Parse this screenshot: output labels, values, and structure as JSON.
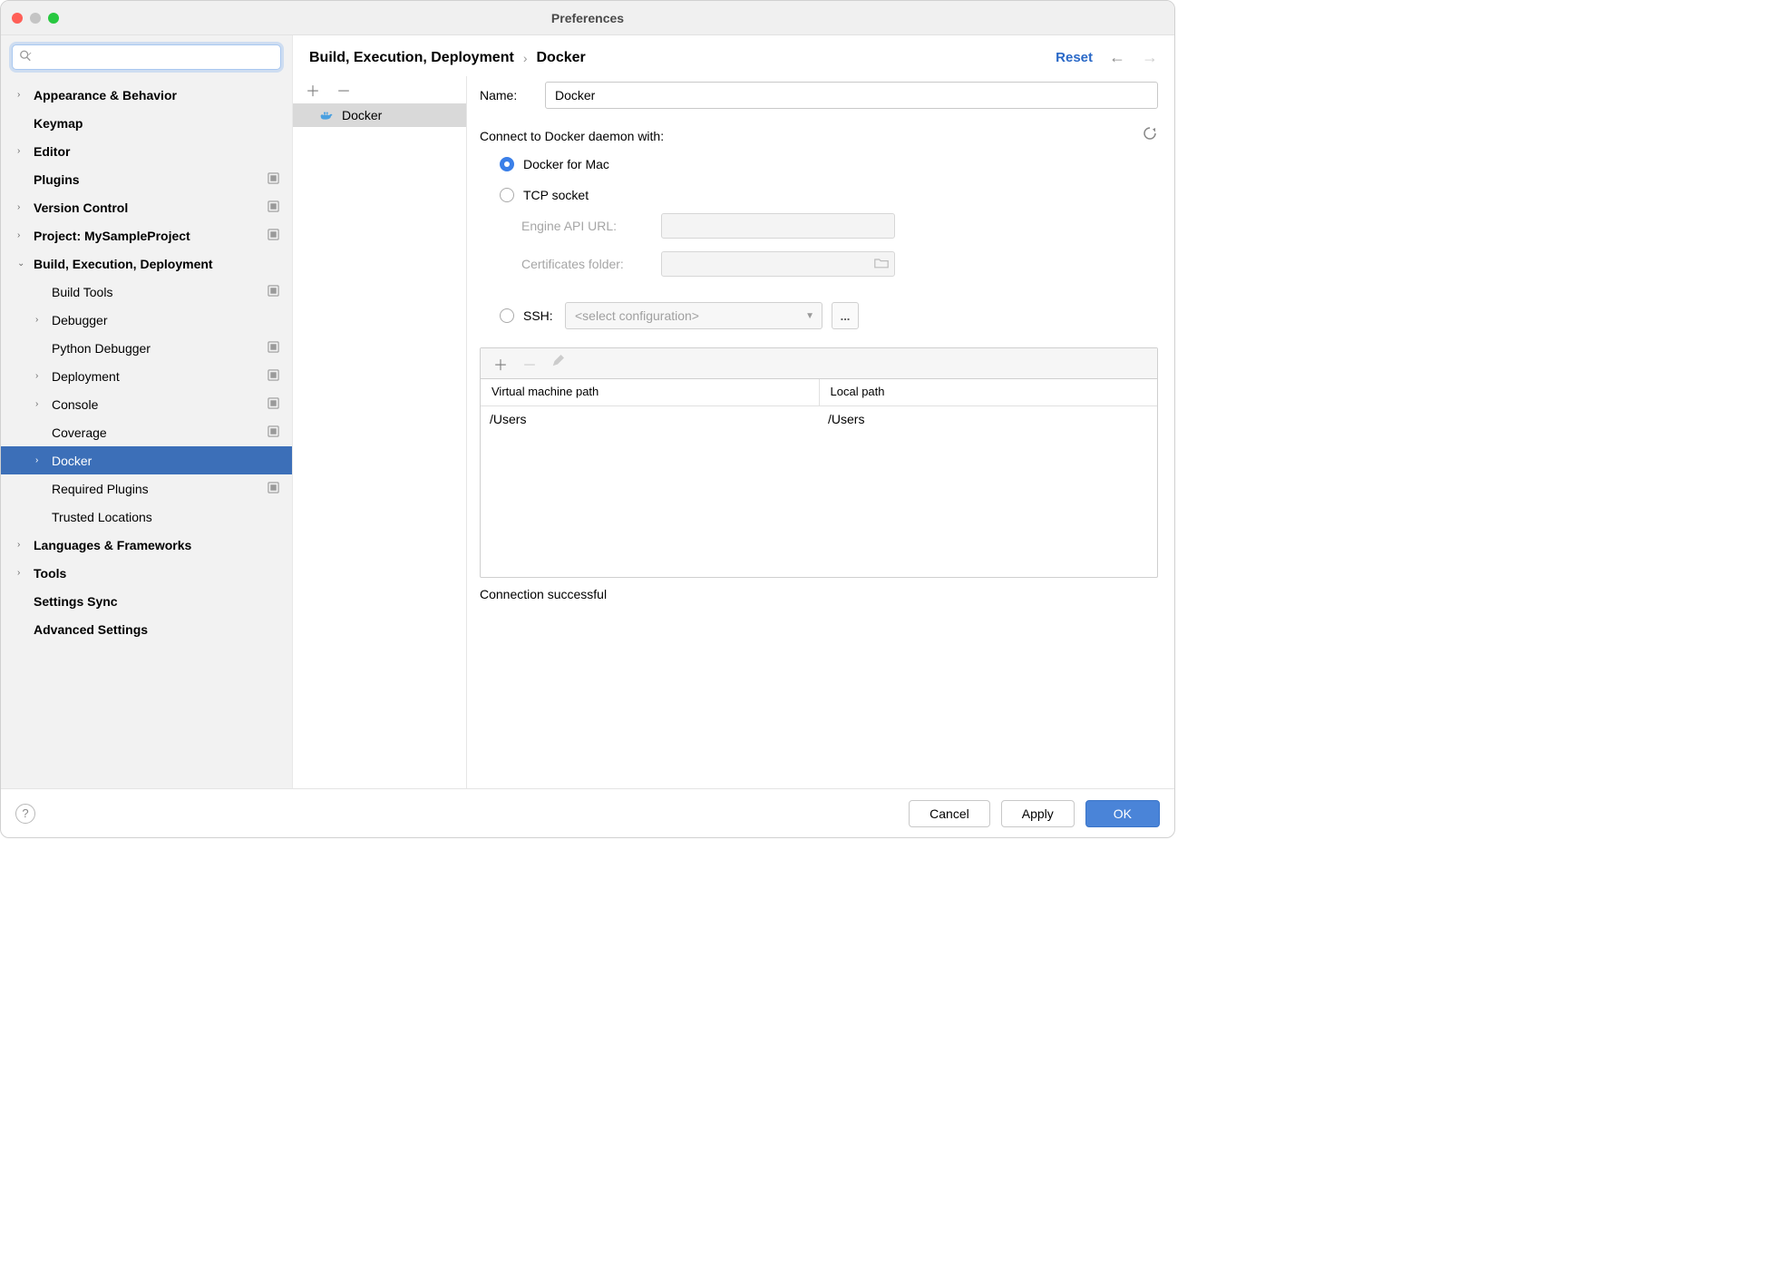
{
  "window": {
    "title": "Preferences"
  },
  "search": {
    "placeholder": ""
  },
  "sidebar": {
    "items": [
      {
        "label": "Appearance & Behavior",
        "bold": true,
        "arrow": ">",
        "badge": false
      },
      {
        "label": "Keymap",
        "bold": true,
        "arrow": "",
        "badge": false
      },
      {
        "label": "Editor",
        "bold": true,
        "arrow": ">",
        "badge": false
      },
      {
        "label": "Plugins",
        "bold": true,
        "arrow": "",
        "badge": true
      },
      {
        "label": "Version Control",
        "bold": true,
        "arrow": ">",
        "badge": true
      },
      {
        "label": "Project: MySampleProject",
        "bold": true,
        "arrow": ">",
        "badge": true
      },
      {
        "label": "Build, Execution, Deployment",
        "bold": true,
        "arrow": "v",
        "badge": false
      },
      {
        "label": "Build Tools",
        "bold": false,
        "arrow": "",
        "level": 1,
        "badge": true
      },
      {
        "label": "Debugger",
        "bold": false,
        "arrow": ">",
        "level": 1,
        "badge": false
      },
      {
        "label": "Python Debugger",
        "bold": false,
        "arrow": "",
        "level": 1,
        "badge": true
      },
      {
        "label": "Deployment",
        "bold": false,
        "arrow": ">",
        "level": 1,
        "badge": true
      },
      {
        "label": "Console",
        "bold": false,
        "arrow": ">",
        "level": 1,
        "badge": true
      },
      {
        "label": "Coverage",
        "bold": false,
        "arrow": "",
        "level": 1,
        "badge": true
      },
      {
        "label": "Docker",
        "bold": false,
        "arrow": ">",
        "level": 1,
        "selected": true,
        "badge": false
      },
      {
        "label": "Required Plugins",
        "bold": false,
        "arrow": "",
        "level": 1,
        "badge": true
      },
      {
        "label": "Trusted Locations",
        "bold": false,
        "arrow": "",
        "level": 1,
        "badge": false
      },
      {
        "label": "Languages & Frameworks",
        "bold": true,
        "arrow": ">",
        "badge": false
      },
      {
        "label": "Tools",
        "bold": true,
        "arrow": ">",
        "badge": false
      },
      {
        "label": "Settings Sync",
        "bold": true,
        "arrow": "",
        "badge": false
      },
      {
        "label": "Advanced Settings",
        "bold": true,
        "arrow": "",
        "badge": false
      }
    ]
  },
  "breadcrumb": {
    "root": "Build, Execution, Deployment",
    "sep": "›",
    "leaf": "Docker"
  },
  "reset": "Reset",
  "config_list": {
    "items": [
      {
        "label": "Docker"
      }
    ]
  },
  "detail": {
    "name_label": "Name:",
    "name_value": "Docker",
    "connect_label": "Connect to Docker daemon with:",
    "radio_mac": "Docker for Mac",
    "radio_tcp": "TCP socket",
    "engine_url_label": "Engine API URL:",
    "cert_folder_label": "Certificates folder:",
    "radio_ssh": "SSH:",
    "ssh_placeholder": "<select configuration>",
    "ellipsis": "...",
    "table": {
      "col1": "Virtual machine path",
      "col2": "Local path",
      "rows": [
        {
          "vm": "/Users",
          "local": "/Users"
        }
      ]
    },
    "status": "Connection successful"
  },
  "footer": {
    "cancel": "Cancel",
    "apply": "Apply",
    "ok": "OK"
  }
}
